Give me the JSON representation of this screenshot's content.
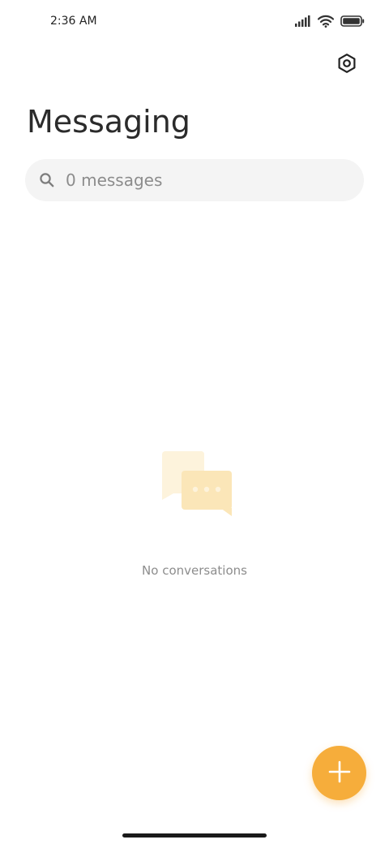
{
  "status_bar": {
    "time": "2:36 AM",
    "icons": [
      "signal-icon",
      "wifi-icon",
      "battery-icon"
    ]
  },
  "header": {
    "title": "Messaging",
    "settings_icon": "settings-icon"
  },
  "search": {
    "placeholder": "0 messages",
    "icon": "search-icon"
  },
  "empty_state": {
    "icon": "conversation-bubbles-icon",
    "text": "No conversations"
  },
  "fab": {
    "icon": "plus-icon"
  },
  "colors": {
    "accent": "#f6ad3b",
    "illustration_light": "#fdf3dc",
    "illustration_mid": "#fbe6b8",
    "search_bg": "#f4f4f4",
    "muted_text": "#8d8d8d"
  }
}
